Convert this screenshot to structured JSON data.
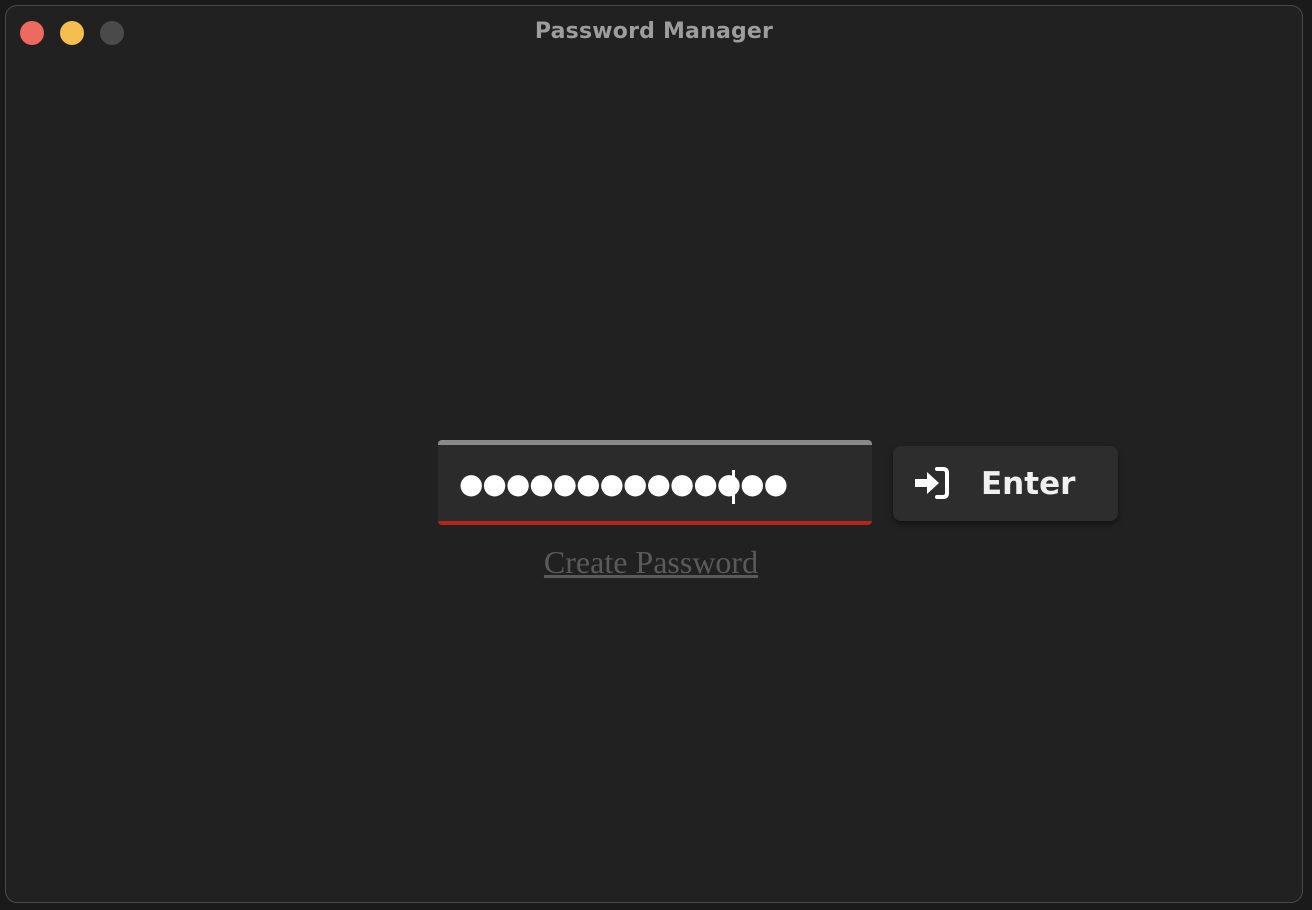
{
  "window": {
    "title": "Password Manager",
    "controls": {
      "close_color": "#ec6a5e",
      "minimize_color": "#f4bf4f",
      "zoom_color": "#4a4a4a"
    }
  },
  "login": {
    "password_masked": "●●●●●●●●●●●●●●",
    "enter_label": "Enter",
    "create_password_label": "Create Password",
    "accent_error_color": "#b3261e"
  },
  "icons": {
    "enter": "sign-in-icon"
  }
}
